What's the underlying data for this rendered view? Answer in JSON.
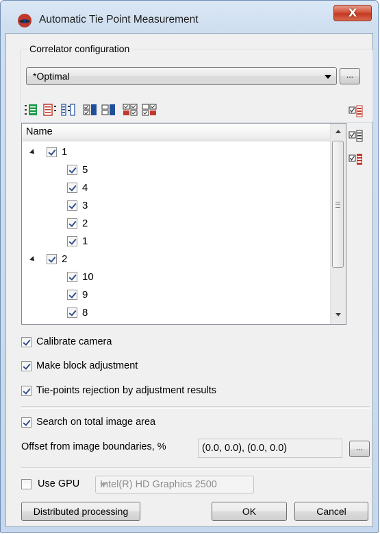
{
  "window": {
    "title": "Automatic Tie Point Measurement",
    "close_glyph": "X"
  },
  "correlator": {
    "group_title": "Correlator configuration",
    "selected": "*Optimal",
    "browse_label": "..."
  },
  "toolbar": {
    "icons": [
      "expand-all-icon",
      "collapse-all-icon",
      "expand-level-icon",
      "check-selected-icon",
      "uncheck-selected-icon",
      "check-all-icon",
      "uncheck-all-icon"
    ],
    "side_icons": [
      "check-red-icon",
      "check-list-icon",
      "check-red-icon-2"
    ]
  },
  "tree": {
    "header": "Name",
    "nodes": [
      {
        "label": "1",
        "level": 0,
        "expanded": true,
        "checked": true
      },
      {
        "label": "5",
        "level": 1,
        "checked": true
      },
      {
        "label": "4",
        "level": 1,
        "checked": true
      },
      {
        "label": "3",
        "level": 1,
        "checked": true
      },
      {
        "label": "2",
        "level": 1,
        "checked": true
      },
      {
        "label": "1",
        "level": 1,
        "checked": true
      },
      {
        "label": "2",
        "level": 0,
        "expanded": true,
        "checked": true
      },
      {
        "label": "10",
        "level": 1,
        "checked": true
      },
      {
        "label": "9",
        "level": 1,
        "checked": true
      },
      {
        "label": "8",
        "level": 1,
        "checked": true
      }
    ]
  },
  "options": {
    "calibrate_camera": {
      "label": "Calibrate camera",
      "checked": true
    },
    "block_adjustment": {
      "label": "Make block adjustment",
      "checked": true
    },
    "tie_rejection": {
      "label": "Tie-points rejection by adjustment results",
      "checked": true
    },
    "search_total": {
      "label": "Search on total image area",
      "checked": true
    }
  },
  "offset": {
    "label": "Offset from image boundaries, %",
    "value": "(0.0, 0.0), (0.0, 0.0)",
    "browse_label": "..."
  },
  "gpu": {
    "label": "Use GPU",
    "checked": false,
    "device": "Intel(R) HD Graphics 2500"
  },
  "buttons": {
    "distributed": "Distributed processing",
    "ok": "OK",
    "cancel": "Cancel"
  }
}
